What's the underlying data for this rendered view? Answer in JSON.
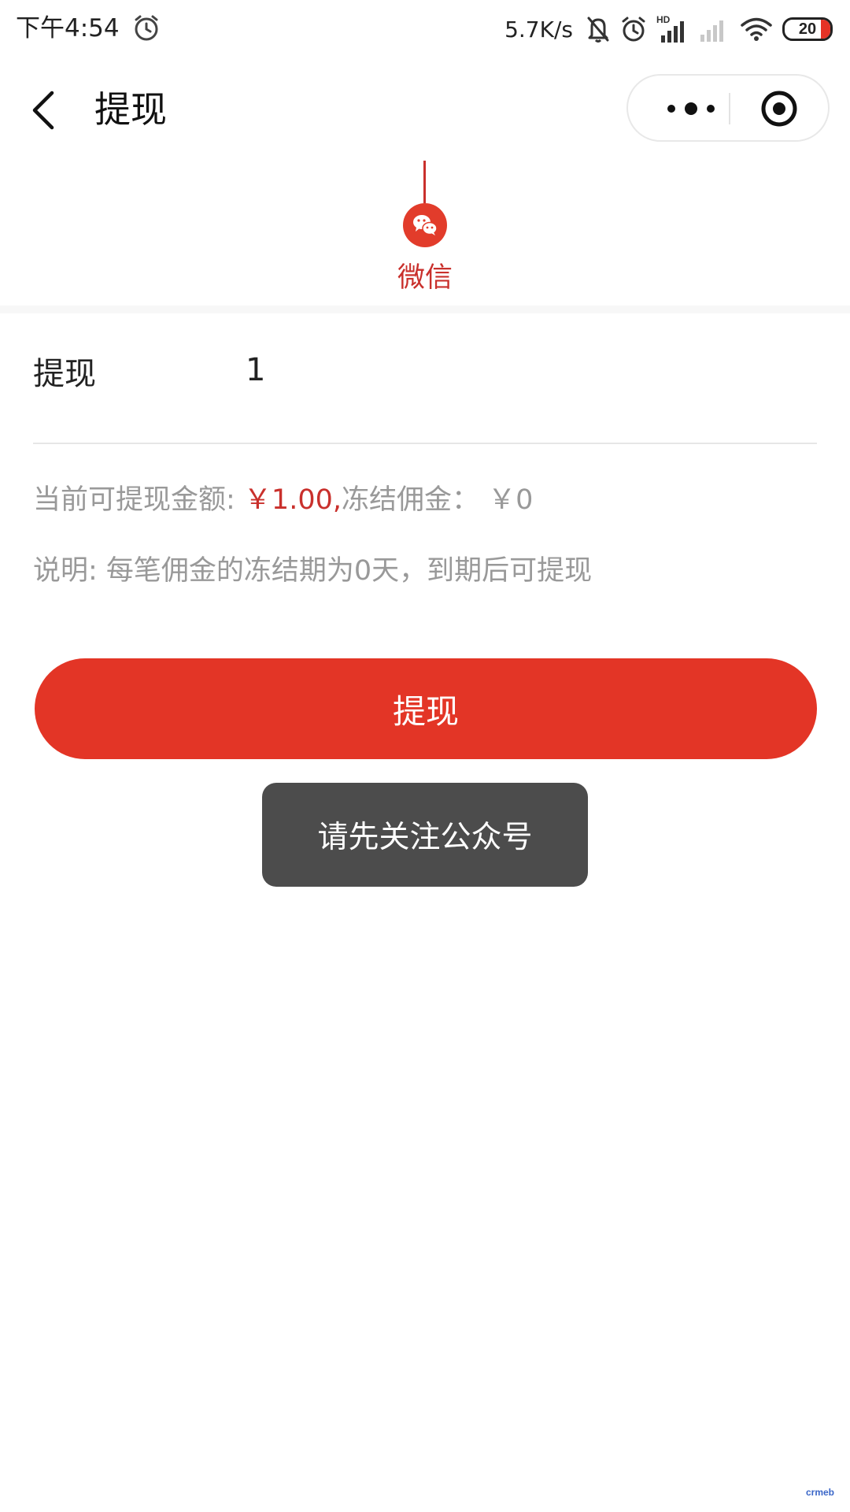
{
  "status_bar": {
    "time": "下午4:54",
    "network_speed": "5.7K/s",
    "battery_level": "20",
    "icons": [
      "alarm-icon",
      "mute-bell-icon",
      "alarm-clock-icon",
      "hd-signal-icon",
      "signal-icon",
      "wifi-icon",
      "battery-icon"
    ]
  },
  "nav": {
    "title": "提现",
    "back_icon": "chevron-left-icon",
    "capsule_icons": [
      "more-dots-icon",
      "close-target-icon"
    ]
  },
  "method": {
    "label": "微信",
    "icon": "wechat-icon",
    "color": "#c9302c"
  },
  "form": {
    "label": "提现",
    "value": "1"
  },
  "info": {
    "available_prefix": "当前可提现金额: ",
    "available_amount": "￥1.00,",
    "frozen_text": "冻结佣金： ￥0",
    "note": "说明: 每笔佣金的冻结期为0天，到期后可提现"
  },
  "button": {
    "label": "提现",
    "color": "#e33526"
  },
  "toast": {
    "message": "请先关注公众号"
  },
  "watermark": "crmeb"
}
